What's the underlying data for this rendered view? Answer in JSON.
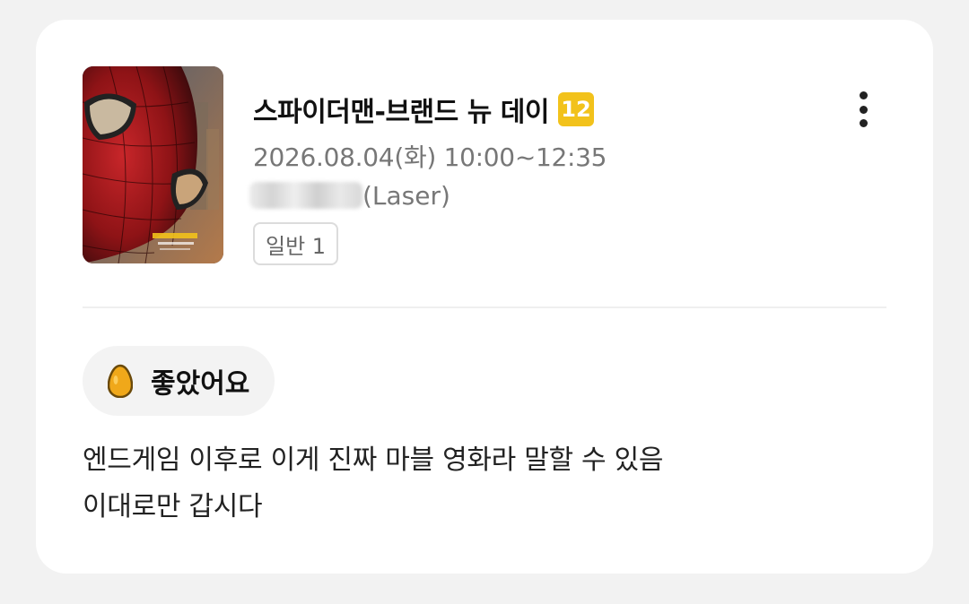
{
  "movie": {
    "title": "스파이더맨-브랜드 뉴 데이",
    "rating": "12",
    "datetime": "2026.08.04(화) 10:00~12:35",
    "theater_suffix": "(Laser)",
    "seat_type": "일반 1"
  },
  "menu": {
    "icon": "more-vertical-icon"
  },
  "review": {
    "reaction_icon": "egg-icon",
    "reaction_label": "좋았어요",
    "lines": [
      "엔드게임 이후로 이게 진짜 마블 영화라 말할 수 있음",
      "이대로만 갑시다"
    ]
  },
  "colors": {
    "rating_badge": "#f2c21b",
    "egg": "#f0a81a",
    "chip_background": "#f3f3f3"
  }
}
